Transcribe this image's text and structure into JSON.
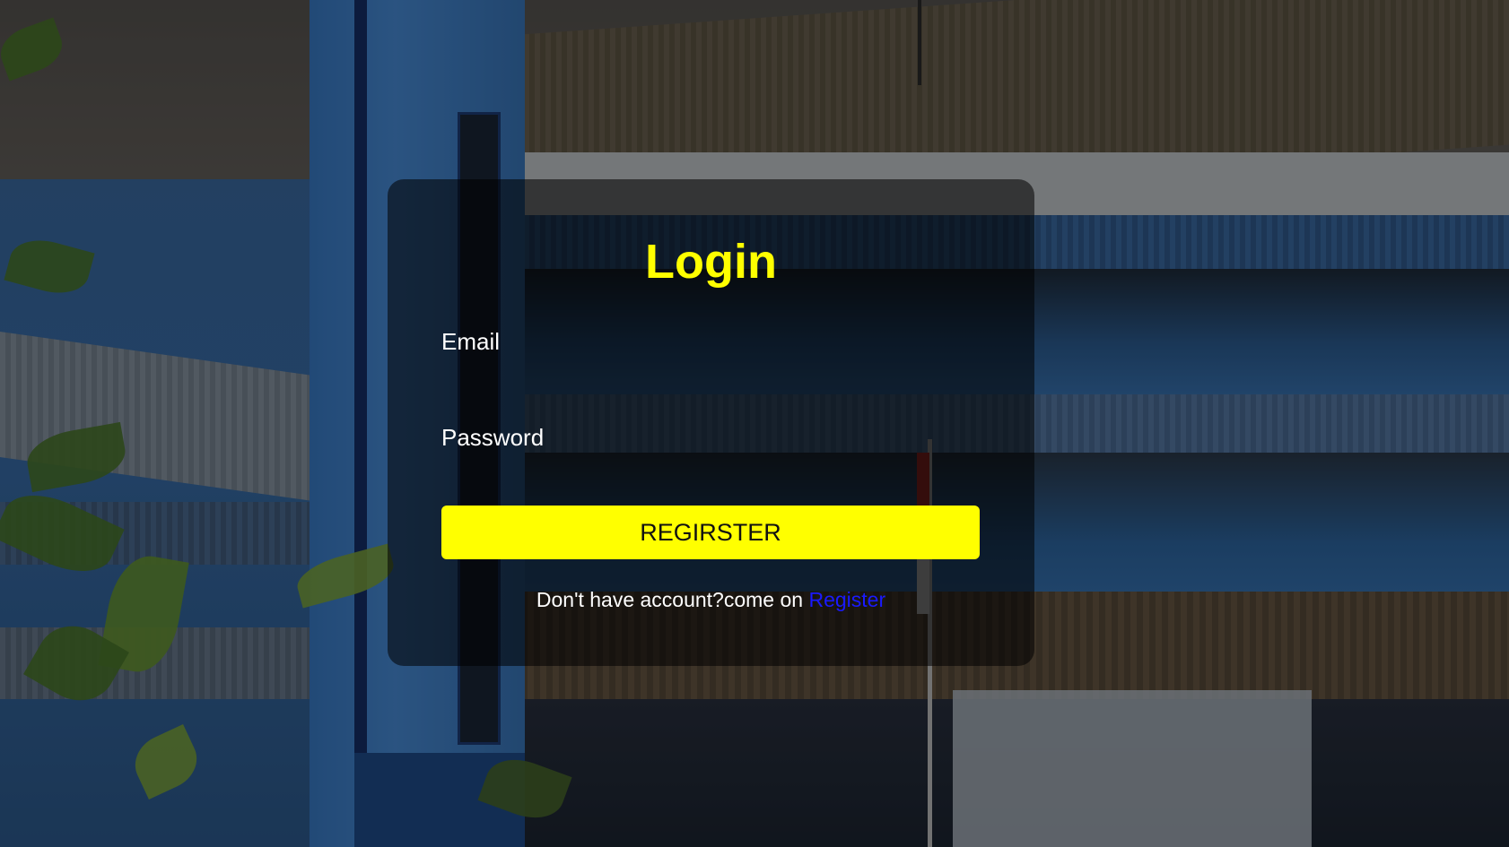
{
  "login": {
    "title": "Login",
    "email_label": "Email",
    "email_value": "",
    "password_label": "Password",
    "password_value": "",
    "submit_label": "REGIRSTER",
    "prompt_text": "Don't have account?come on ",
    "register_link": "Register"
  },
  "background": {
    "description_icon": "school-building-photo"
  },
  "colors": {
    "accent": "#ffff00",
    "link": "#1a1aff",
    "text": "#ffffff",
    "card_overlay": "rgba(0,0,0,0.55)"
  }
}
